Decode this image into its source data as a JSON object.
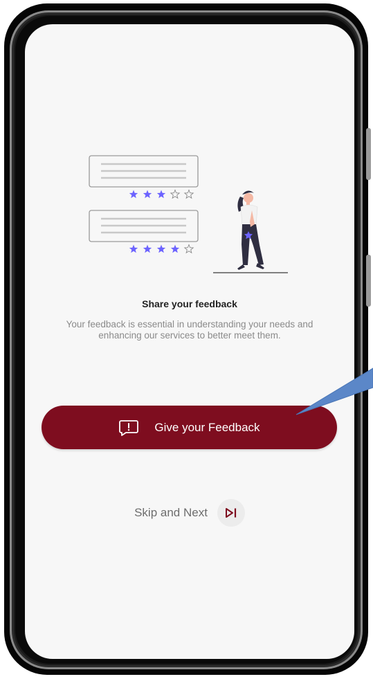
{
  "screen": {
    "title": "Share your feedback",
    "description": "Your feedback is essential in understanding your needs and enhancing our services to better meet them."
  },
  "actions": {
    "feedback_button_label": "Give your Feedback",
    "feedback_icon": "message-alert-icon",
    "skip_label": "Skip and Next",
    "skip_icon": "skip-next-icon"
  },
  "illustration": {
    "review_1_rating": 3,
    "review_2_rating": 4,
    "max_rating": 5
  },
  "colors": {
    "accent": "#7e0d1f",
    "star": "#6c63ff",
    "background": "#f7f7f7"
  }
}
